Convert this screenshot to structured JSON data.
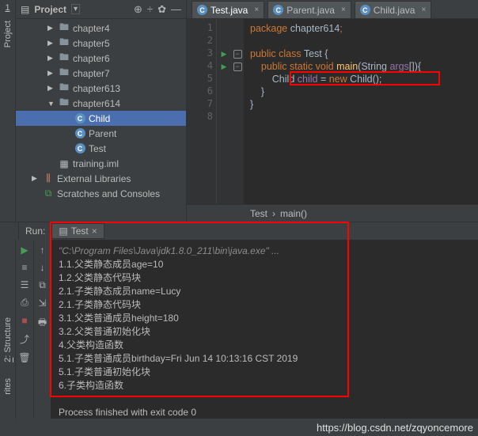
{
  "left_gutter_top": {
    "num": "1",
    "label": "Project"
  },
  "left_gutter_bottom": {
    "num": "2",
    "label": "Structure",
    "other": "rites"
  },
  "sidebar": {
    "title": "Project",
    "items": [
      {
        "depth": "d1",
        "arrow": "▶",
        "iconType": "folder",
        "label": "chapter4"
      },
      {
        "depth": "d1",
        "arrow": "▶",
        "iconType": "folder",
        "label": "chapter5"
      },
      {
        "depth": "d1",
        "arrow": "▶",
        "iconType": "folder",
        "label": "chapter6"
      },
      {
        "depth": "d1",
        "arrow": "▶",
        "iconType": "folder",
        "label": "chapter7"
      },
      {
        "depth": "d1",
        "arrow": "▶",
        "iconType": "folder",
        "label": "chapter613"
      },
      {
        "depth": "d1",
        "arrow": "▼",
        "iconType": "folder",
        "label": "chapter614"
      },
      {
        "depth": "d2",
        "arrow": "",
        "iconType": "class",
        "label": "Child",
        "selected": true
      },
      {
        "depth": "d2",
        "arrow": "",
        "iconType": "class",
        "label": "Parent"
      },
      {
        "depth": "d2",
        "arrow": "",
        "iconType": "class",
        "label": "Test"
      },
      {
        "depth": "d1",
        "arrow": "",
        "iconType": "file",
        "label": "training.iml"
      },
      {
        "depth": "d0",
        "arrow": "▶",
        "iconType": "lib",
        "label": "External Libraries"
      },
      {
        "depth": "d0",
        "arrow": "",
        "iconType": "scratch",
        "label": "Scratches and Consoles"
      }
    ]
  },
  "tabs": [
    {
      "label": "Test.java",
      "active": true
    },
    {
      "label": "Parent.java",
      "active": false
    },
    {
      "label": "Child.java",
      "active": false
    }
  ],
  "code_lines": [
    "1",
    "2",
    "3",
    "4",
    "5",
    "6",
    "7",
    "8"
  ],
  "code": {
    "l1a": "package ",
    "l1b": "chapter614",
    "l1c": ";",
    "l3a": "public class ",
    "l3b": "Test ",
    "l3c": "{",
    "l4a": "    public static void ",
    "l4b": "main",
    "l4c": "(String ",
    "l4d": "args",
    "l4e": "[]){",
    "l5a": "        Child ",
    "l5b": "child ",
    "l5c": "= ",
    "l5d": "new ",
    "l5e": "Child();",
    "l6": "    }",
    "l7": "}"
  },
  "breadcrumb": {
    "a": "Test",
    "b": "main()"
  },
  "run": {
    "label": "Run:",
    "tab": "Test",
    "cmd": "\"C:\\Program Files\\Java\\jdk1.8.0_211\\bin\\java.exe\" ...",
    "lines": [
      "1.1.父类静态成员age=10",
      "1.2.父类静态代码块",
      "2.1.子类静态成员name=Lucy",
      "2.1.子类静态代码块",
      "3.1.父类普通成员height=180",
      "3.2.父类普通初始化块",
      "4.父类构造函数",
      "5.1.子类普通成员birthday=Fri Jun 14 10:13:16 CST 2019",
      "5.1.子类普通初始化块",
      "6.子类构造函数"
    ],
    "exit": "Process finished with exit code 0"
  },
  "watermark": "https://blog.csdn.net/zqyoncemore"
}
